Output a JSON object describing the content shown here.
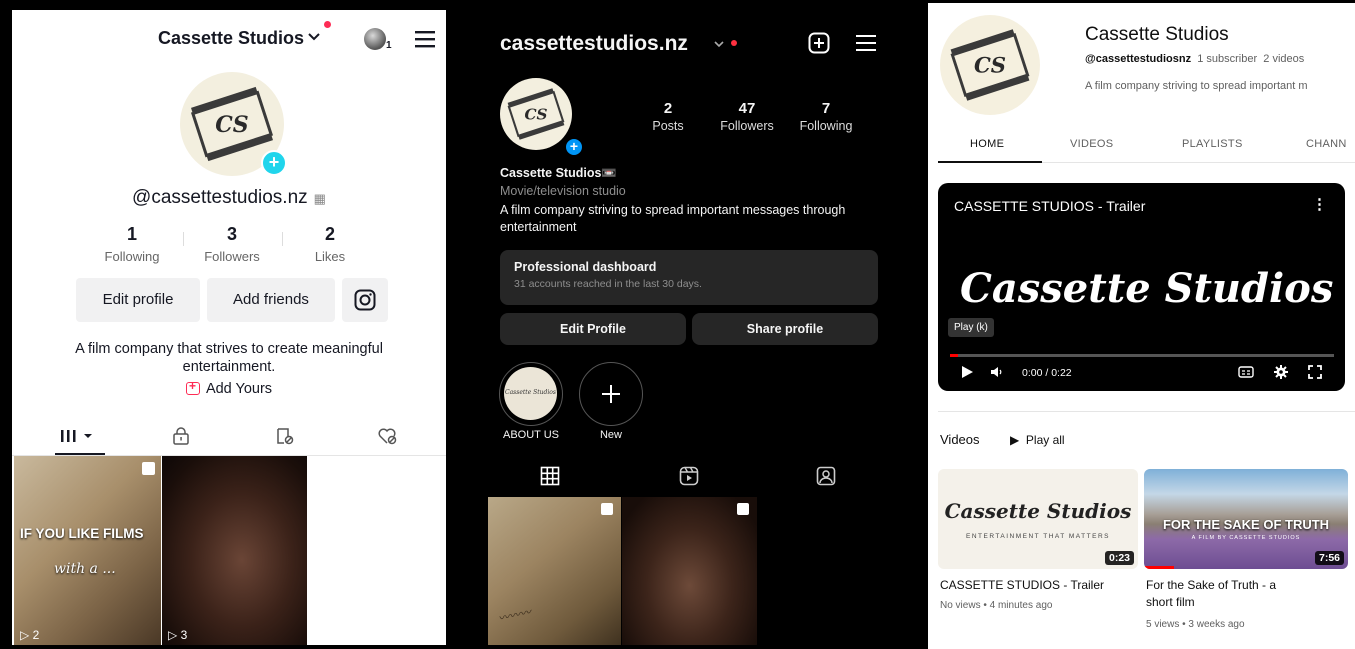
{
  "tiktok": {
    "title": "Cassette Studios",
    "notification_count": "1",
    "handle": "@cassettestudios.nz",
    "stats": [
      {
        "value": "1",
        "label": "Following"
      },
      {
        "value": "3",
        "label": "Followers"
      },
      {
        "value": "2",
        "label": "Likes"
      }
    ],
    "buttons": {
      "edit": "Edit profile",
      "add_friends": "Add friends"
    },
    "bio": "A film company that strives to create meaningful entertainment.",
    "add_yours": "Add Yours",
    "videos": [
      {
        "overlay_line1": "IF YOU LIKE FILMS",
        "overlay_line2": "with a ...",
        "views": "2"
      },
      {
        "views": "3"
      }
    ],
    "avatar_text": "CS"
  },
  "instagram": {
    "handle": "cassettestudios.nz",
    "stats": [
      {
        "value": "2",
        "label": "Posts"
      },
      {
        "value": "47",
        "label": "Followers"
      },
      {
        "value": "7",
        "label": "Following"
      }
    ],
    "name": "Cassette Studios📼",
    "category": "Movie/television studio",
    "bio": "A film company striving to spread important messages through entertainment",
    "dashboard": {
      "title": "Professional dashboard",
      "subtitle": "31 accounts reached in the last 30 days."
    },
    "buttons": {
      "edit": "Edit Profile",
      "share": "Share profile"
    },
    "highlights": [
      {
        "label": "ABOUT US",
        "cover_text": "Cassette Studios"
      },
      {
        "label": "New"
      }
    ],
    "avatar_text": "CS"
  },
  "youtube": {
    "channel_name": "Cassette Studios",
    "handle": "@cassettestudiosnz",
    "subscribers": "1 subscriber",
    "video_count": "2 videos",
    "description": "A film company striving to spread important m",
    "tabs": [
      "HOME",
      "VIDEOS",
      "PLAYLISTS",
      "CHANN"
    ],
    "player": {
      "title": "CASSETTE STUDIOS - Trailer",
      "logo": "Cassette Studios",
      "tooltip": "Play (k)",
      "time": "0:00 / 0:22",
      "progress": 0.02
    },
    "videos_heading": "Videos",
    "play_all": "Play all",
    "videos": [
      {
        "title": "CASSETTE STUDIOS - Trailer",
        "meta": "No views • 4 minutes ago",
        "duration": "0:23",
        "thumb_logo": "Cassette Studios",
        "thumb_sub": "ENTERTAINMENT THAT MATTERS"
      },
      {
        "title_line1": "For the Sake of Truth - a",
        "title_line2": "short film",
        "meta": "5 views • 3 weeks ago",
        "duration": "7:56",
        "thumb_title": "FOR THE SAKE OF TRUTH",
        "thumb_sub": "A FILM BY CASSETTE STUDIOS"
      }
    ],
    "avatar_text": "CS"
  },
  "colors": {
    "tiktok_pink": "#fe2c55",
    "tiktok_cyan": "#20d5ec",
    "instagram_blue": "#0095f6",
    "youtube_red": "#ff0000"
  }
}
